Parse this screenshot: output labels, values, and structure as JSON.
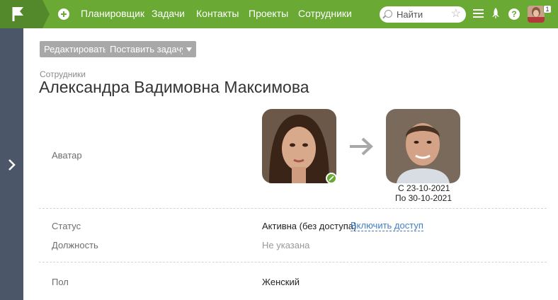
{
  "nav": {
    "items": [
      "Планировщик",
      "Задачи",
      "Контакты",
      "Проекты",
      "Сотрудники"
    ],
    "search_placeholder": "Найти",
    "notification_count": "1",
    "help_label": "?"
  },
  "toolbar": {
    "edit_label": "Редактировать",
    "assign_task_label": "Поставить задачу"
  },
  "page": {
    "breadcrumb": "Сотрудники",
    "title": "Александра Вадимовна Максимова"
  },
  "fields": {
    "avatar_label": "Аватар",
    "avatar_from": "С 23-10-2021",
    "avatar_to": "По 30-10-2021",
    "status_label": "Статус",
    "status_value": "Активна (без доступа)",
    "enable_access_link": "Включить доступ",
    "position_label": "Должность",
    "position_value": "Не указана",
    "gender_label": "Пол",
    "gender_value": "Женский"
  },
  "colors": {
    "topbar": "#6aaa34",
    "logo_bg": "#53892a",
    "side_panel": "#4b5768",
    "button_bg": "#a8a8a8",
    "link": "#3f7fc8"
  },
  "icons": [
    "flag-logo-icon",
    "plus-icon",
    "search-icon",
    "star-icon",
    "menu-icon",
    "rocket-icon",
    "help-icon",
    "chevron-right-icon",
    "arrow-right-icon",
    "edit-icon",
    "dropdown-caret-icon"
  ]
}
